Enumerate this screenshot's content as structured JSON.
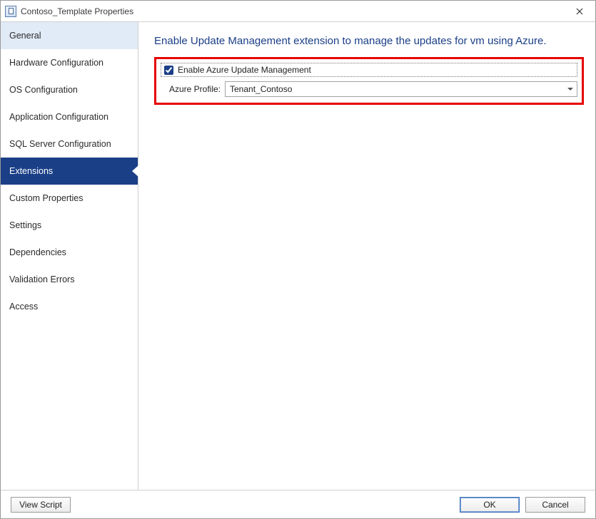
{
  "window": {
    "title": "Contoso_Template Properties"
  },
  "sidebar": {
    "items": [
      {
        "label": "General"
      },
      {
        "label": "Hardware Configuration"
      },
      {
        "label": "OS Configuration"
      },
      {
        "label": "Application Configuration"
      },
      {
        "label": "SQL Server Configuration"
      },
      {
        "label": "Extensions"
      },
      {
        "label": "Custom Properties"
      },
      {
        "label": "Settings"
      },
      {
        "label": "Dependencies"
      },
      {
        "label": "Validation Errors"
      },
      {
        "label": "Access"
      }
    ],
    "selected_index": 5
  },
  "content": {
    "heading": "Enable Update Management extension to manage the updates for vm using Azure.",
    "enable_checkbox_label": "Enable Azure Update Management",
    "enable_checkbox_checked": true,
    "azure_profile_label": "Azure Profile:",
    "azure_profile_value": "Tenant_Contoso"
  },
  "footer": {
    "view_script_label": "View Script",
    "ok_label": "OK",
    "cancel_label": "Cancel"
  }
}
